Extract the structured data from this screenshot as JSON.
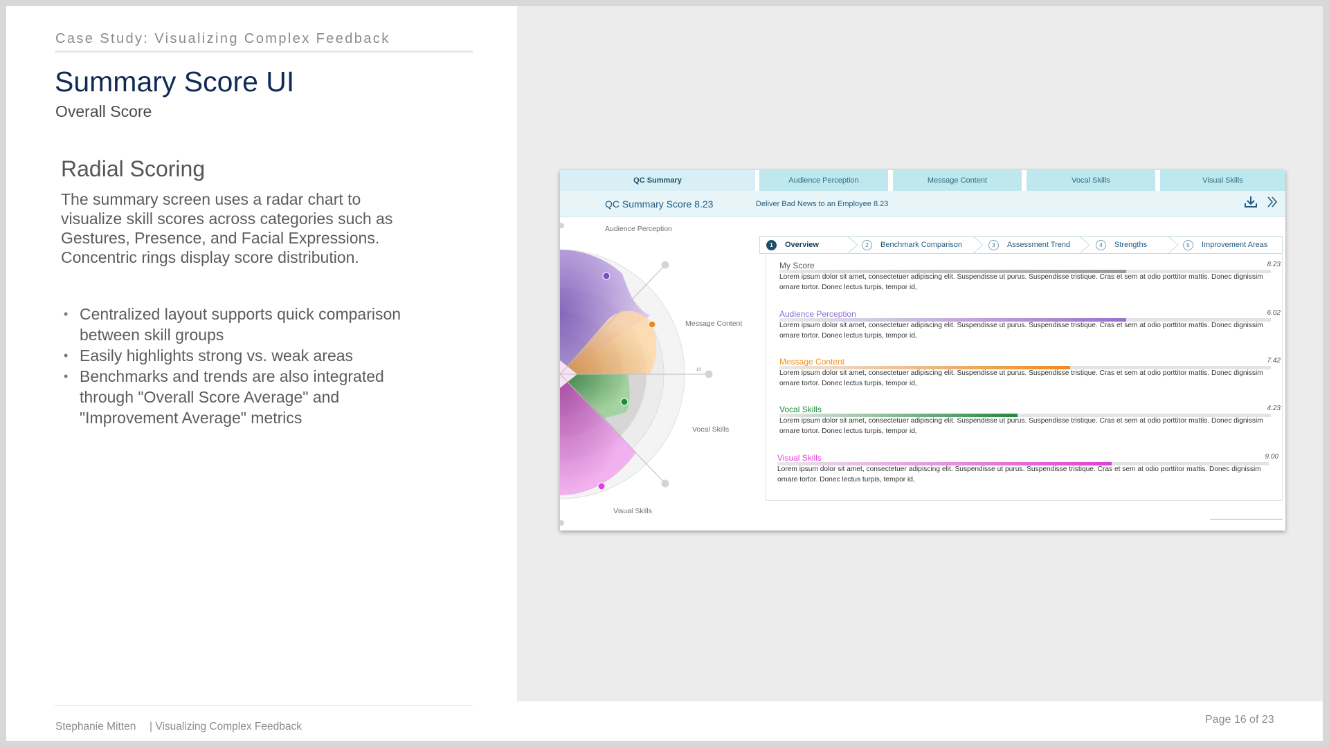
{
  "header": {
    "eyebrow": "Case Study: Visualizing Complex Feedback",
    "title": "Summary Score UI",
    "subtitle": "Overall Score"
  },
  "content": {
    "section_title": "Radial Scoring",
    "body": "The summary screen uses a radar chart to visualize skill scores across categories such as Gestures, Presence, and Facial Expressions. Concentric rings display score distribution.",
    "bullets": [
      "Centralized layout supports quick comparison between skill groups",
      "Easily highlights strong vs. weak areas",
      "Benchmarks and trends are also integrated through \"Overall Score Average\" and \"Improvement Average\" metrics"
    ]
  },
  "footer": {
    "author": "Stephanie Mitten",
    "doc_title": "| Visualizing Complex Feedback",
    "page": "Page 16 of 23"
  },
  "app": {
    "tabs": [
      {
        "label": "QC Summary",
        "active": true
      },
      {
        "label": "Audience Perception",
        "active": false
      },
      {
        "label": "Message Content",
        "active": false
      },
      {
        "label": "Vocal Skills",
        "active": false
      },
      {
        "label": "Visual Skills",
        "active": false
      }
    ],
    "summary_title": "QC Summary Score 8.23",
    "summary_sub": "Deliver Bad News to an Employee  8.23",
    "icons": [
      "download-icon",
      "double-chevron-right-icon"
    ],
    "radar": {
      "labels": [
        "Audience Perception",
        "Message Content",
        "Vocal Skills",
        "Visual Skills"
      ],
      "tick_label": "10",
      "colors": {
        "audience": "#9b6fd0",
        "message": "#f08a1c",
        "vocal": "#1e8a3c",
        "visual": "#e23fd6"
      }
    },
    "steps": [
      {
        "num": "1",
        "label": "Overview",
        "active": true
      },
      {
        "num": "2",
        "label": "Benchmark Comparison",
        "active": false
      },
      {
        "num": "3",
        "label": "Assessment Trend",
        "active": false
      },
      {
        "num": "4",
        "label": "Strengths",
        "active": false
      },
      {
        "num": "5",
        "label": "Improvement Areas",
        "active": false
      }
    ],
    "scores": [
      {
        "label": "My Score",
        "value": "8.23",
        "fraction": 0.706,
        "color": "#9a9a9a",
        "label_color": "#555555",
        "desc": "Lorem ipsum dolor sit amet, consectetuer adipiscing elit. Suspendisse ut purus. Suspendisse tristique. Cras et sem at odio porttitor mattis. Donec dignissim ornare tortor. Donec lectus turpis, tempor id,"
      },
      {
        "label": "Audience Perception",
        "value": "6.02",
        "fraction": 0.706,
        "color": "#9b6fd0",
        "label_color": "#8a6fd6",
        "desc": "Lorem ipsum dolor sit amet, consectetuer adipiscing elit. Suspendisse ut purus. Suspendisse tristique. Cras et sem at odio porttitor mattis. Donec dignissim ornare tortor. Donec lectus turpis, tempor id,"
      },
      {
        "label": "Message Content",
        "value": "7.42",
        "fraction": 0.592,
        "color": "#f08a1c",
        "label_color": "#f0901c",
        "desc": "Lorem ipsum dolor sit amet, consectetuer adipiscing elit. Suspendisse ut purus. Suspendisse tristique. Cras et sem at odio porttitor mattis. Donec dignissim ornare tortor. Donec lectus turpis, tempor id,"
      },
      {
        "label": "Vocal Skills",
        "value": "4.23",
        "fraction": 0.485,
        "color": "#1e8a3c",
        "label_color": "#1e8a3c",
        "desc": "Lorem ipsum dolor sit amet, consectetuer adipiscing elit. Suspendisse ut purus. Suspendisse tristique. Cras et sem at odio porttitor mattis. Donec dignissim ornare tortor. Donec lectus turpis, tempor id,"
      },
      {
        "label": "Visual Skills",
        "value": "9.00",
        "fraction": 0.68,
        "color": "#e23fd6",
        "label_color": "#e23fd6",
        "desc": "Lorem ipsum dolor sit amet, consectetuer adipiscing elit. Suspendisse ut purus. Suspendisse tristique. Cras et sem at odio porttitor mattis. Donec dignissim ornare tortor. Donec lectus turpis, tempor id,"
      }
    ]
  }
}
